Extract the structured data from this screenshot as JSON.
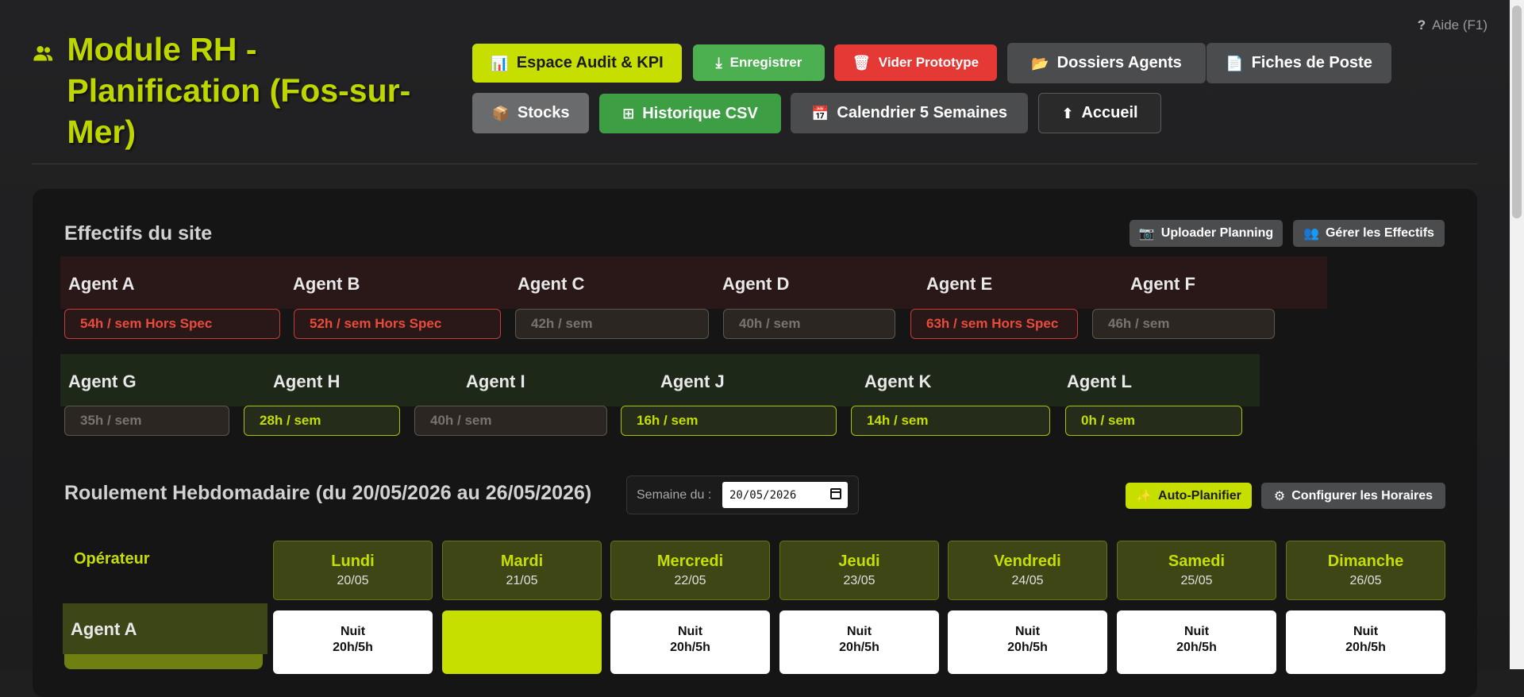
{
  "help": {
    "label": "Aide (F1)"
  },
  "header": {
    "title": "Module RH - Planification (Fos-sur-Mer)"
  },
  "toolbar": {
    "audit": {
      "label": "Espace Audit & KPI",
      "icon": "chart-icon"
    },
    "save": {
      "label": "Enregistrer",
      "icon": "download-icon"
    },
    "clear": {
      "label": "Vider Prototype",
      "icon": "trash-icon"
    },
    "dossiers": {
      "label": "Dossiers Agents",
      "icon": "folder-icon"
    },
    "fiches": {
      "label": "Fiches de Poste",
      "icon": "document-icon"
    },
    "stocks": {
      "label": "Stocks",
      "icon": "box-icon"
    },
    "csv": {
      "label": "Historique CSV",
      "icon": "plus-icon"
    },
    "calendar": {
      "label": "Calendrier 5 Semaines",
      "icon": "calendar-icon"
    },
    "home": {
      "label": "Accueil",
      "icon": "arrow-up-icon"
    }
  },
  "effectifs": {
    "title": "Effectifs du site",
    "upload_label": "Uploader Planning",
    "manage_label": "Gérer les Effectifs",
    "agents": [
      {
        "name": "Agent A",
        "hours": "54h / sem Hors Spec",
        "status": "over"
      },
      {
        "name": "Agent B",
        "hours": "52h / sem Hors Spec",
        "status": "over"
      },
      {
        "name": "Agent C",
        "hours": "42h / sem",
        "status": "normal"
      },
      {
        "name": "Agent D",
        "hours": "40h / sem",
        "status": "normal"
      },
      {
        "name": "Agent E",
        "hours": "63h / sem Hors Spec",
        "status": "over"
      },
      {
        "name": "Agent F",
        "hours": "46h / sem",
        "status": "normal"
      },
      {
        "name": "Agent G",
        "hours": "35h / sem",
        "status": "normal"
      },
      {
        "name": "Agent H",
        "hours": "28h / sem",
        "status": "ok"
      },
      {
        "name": "Agent I",
        "hours": "40h / sem",
        "status": "normal"
      },
      {
        "name": "Agent J",
        "hours": "16h / sem",
        "status": "ok"
      },
      {
        "name": "Agent K",
        "hours": "14h / sem",
        "status": "ok"
      },
      {
        "name": "Agent L",
        "hours": "0h / sem",
        "status": "ok"
      }
    ]
  },
  "roulement": {
    "title": "Roulement Hebdomadaire (du 20/05/2026 au 26/05/2026)",
    "week_label": "Semaine du :",
    "week_value": "20/05/2026",
    "auto_label": "Auto-Planifier",
    "config_label": "Configurer les Horaires",
    "operator_label": "Opérateur",
    "days": [
      {
        "name": "Lundi",
        "date": "20/05"
      },
      {
        "name": "Mardi",
        "date": "21/05"
      },
      {
        "name": "Mercredi",
        "date": "22/05"
      },
      {
        "name": "Jeudi",
        "date": "23/05"
      },
      {
        "name": "Vendredi",
        "date": "24/05"
      },
      {
        "name": "Samedi",
        "date": "25/05"
      },
      {
        "name": "Dimanche",
        "date": "26/05"
      }
    ],
    "rows": [
      {
        "agent": "Agent A",
        "shifts": [
          {
            "l1": "Nuit",
            "l2": "20h/5h"
          },
          {
            "l1": "",
            "l2": ""
          },
          {
            "l1": "Nuit",
            "l2": "20h/5h"
          },
          {
            "l1": "Nuit",
            "l2": "20h/5h"
          },
          {
            "l1": "Nuit",
            "l2": "20h/5h"
          },
          {
            "l1": "Nuit",
            "l2": "20h/5h"
          },
          {
            "l1": "Nuit",
            "l2": "20h/5h"
          }
        ]
      }
    ]
  },
  "colors": {
    "accent": "#c6df00",
    "danger": "#e53935",
    "success": "#4caf50",
    "panel": "#151516"
  }
}
